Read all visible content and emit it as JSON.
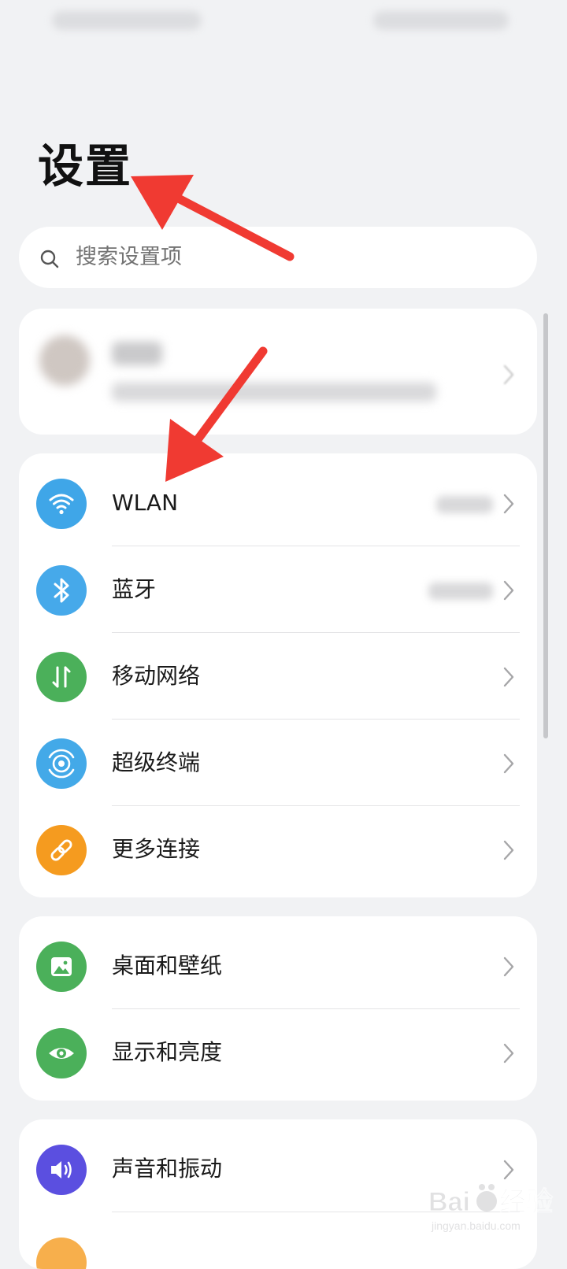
{
  "header": {
    "title": "设置"
  },
  "search": {
    "placeholder": "搜索设置项"
  },
  "groups": [
    {
      "items": [
        {
          "label": "WLAN",
          "icon": "wifi-icon",
          "color": "#3fa6e8"
        },
        {
          "label": "蓝牙",
          "icon": "bluetooth-icon",
          "color": "#46a9ea"
        },
        {
          "label": "移动网络",
          "icon": "mobile-data-icon",
          "color": "#4bb05a"
        },
        {
          "label": "超级终端",
          "icon": "super-device-icon",
          "color": "#43a9e8"
        },
        {
          "label": "更多连接",
          "icon": "link-icon",
          "color": "#f59b1f"
        }
      ]
    },
    {
      "items": [
        {
          "label": "桌面和壁纸",
          "icon": "wallpaper-icon",
          "color": "#4bb05a"
        },
        {
          "label": "显示和亮度",
          "icon": "eye-icon",
          "color": "#4bb05a"
        }
      ]
    },
    {
      "items": [
        {
          "label": "声音和振动",
          "icon": "volume-icon",
          "color": "#5b4fe0"
        }
      ]
    }
  ],
  "colors": {
    "background": "#f1f2f4",
    "card": "#ffffff",
    "annotation_arrow": "#f03a32"
  },
  "watermark": {
    "text": "Baidu经验",
    "sub": "jingyan.baidu.com"
  }
}
